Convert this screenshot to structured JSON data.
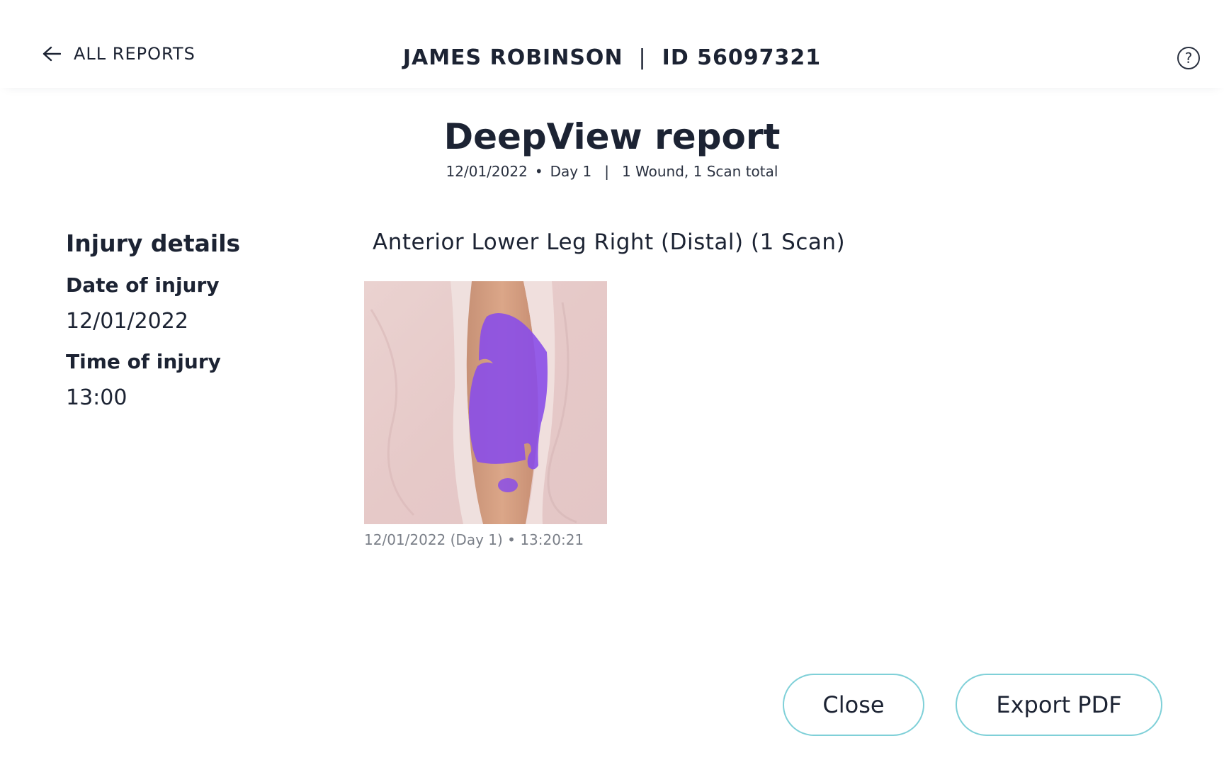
{
  "header": {
    "back_label": "ALL REPORTS",
    "patient_name": "JAMES ROBINSON",
    "separator": "|",
    "patient_id": "ID 56097321",
    "help_symbol": "?"
  },
  "report": {
    "title": "DeepView report",
    "date": "12/01/2022",
    "dot": "•",
    "day": "Day 1",
    "bar": "|",
    "summary": "1 Wound, 1 Scan total"
  },
  "injury": {
    "heading": "Injury details",
    "date_label": "Date of injury",
    "date_value": "12/01/2022",
    "time_label": "Time of injury",
    "time_value": "13:00"
  },
  "wound": {
    "title": "Anterior Lower Leg Right (Distal) (1 Scan)",
    "scans": [
      {
        "caption": "12/01/2022 (Day 1) • 13:20:21"
      }
    ]
  },
  "actions": {
    "close_label": "Close",
    "export_label": "Export PDF"
  },
  "icons": {
    "back": "arrow-left-icon",
    "help": "help-circle-icon"
  },
  "colors": {
    "text": "#1c2333",
    "button_border": "#7fd0d8",
    "wound_overlay": "#8a4ee8",
    "caption": "#7a7f88"
  }
}
